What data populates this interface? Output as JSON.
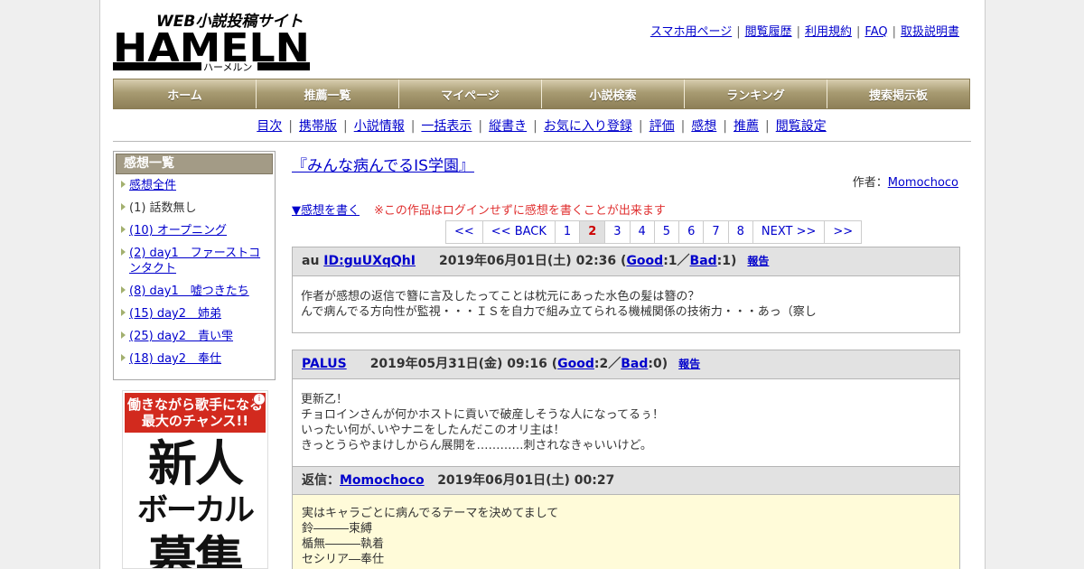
{
  "header": {
    "logo_tagline": "WEB小説投稿サイト",
    "logo_name": "HAMELN",
    "logo_kana": "ハーメルン",
    "links": [
      "スマホ用ページ",
      "閲覧履歴",
      "利用規約",
      "FAQ",
      "取扱説明書"
    ]
  },
  "global_nav": [
    "ホーム",
    "推薦一覧",
    "マイページ",
    "小説検索",
    "ランキング",
    "捜索掲示板"
  ],
  "sub_nav": [
    "目次",
    "携帯版",
    "小説情報",
    "一括表示",
    "縦書き",
    "お気に入り登録",
    "評価",
    "感想",
    "推薦",
    "閲覧設定"
  ],
  "sidebar": {
    "title": "感想一覧",
    "items": [
      {
        "label": "感想全件",
        "link": true
      },
      {
        "label": "(1) 話数無し",
        "link": false
      },
      {
        "label": "(10) オープニング",
        "link": true
      },
      {
        "label": "(2) day1　ファーストコンタクト",
        "link": true
      },
      {
        "label": "(8) day1　嘘つきたち",
        "link": true
      },
      {
        "label": "(15) day2　姉弟",
        "link": true
      },
      {
        "label": "(25) day2　青い雫",
        "link": true
      },
      {
        "label": "(18) day2　奉仕",
        "link": true
      }
    ]
  },
  "ad": {
    "line1": "働きながら歌手になる",
    "line2": "最大のチャンス!!",
    "big": "新人",
    "mid": "ボーカル",
    "cut": "募集"
  },
  "main": {
    "title": "『みんな病んでるIS学園』",
    "author_label": "作者：",
    "author": "Momochoco",
    "write_link": "▼感想を書く",
    "warning": "※この作品はログインせずに感想を書くことが出来ます",
    "pager": [
      "<<",
      "<< BACK",
      "1",
      "2",
      "3",
      "4",
      "5",
      "6",
      "7",
      "8",
      "NEXT >>",
      ">>"
    ],
    "current_page": "2",
    "reviews": [
      {
        "prefix": "au ",
        "user": "ID:guUXqQhI",
        "date": "2019年06月01日(土) 02:36",
        "good_label": "Good",
        "good": ":1",
        "slash": "／",
        "bad_label": "Bad",
        "bad": ":1",
        "report": "報告",
        "lines": [
          "作者が感想の返信で簪に言及したってことは枕元にあった水色の髪は簪の？",
          "んで病んでる方向性が監視・・・ＩＳを自力で組み立てられる機械関係の技術力・・・あっ（察し"
        ]
      },
      {
        "prefix": "",
        "user": "PALUS",
        "date": "2019年05月31日(金) 09:16",
        "good_label": "Good",
        "good": ":2",
        "slash": "／",
        "bad_label": "Bad",
        "bad": ":0",
        "report": "報告",
        "lines": [
          "更新乙！",
          "チョロインさんが何かホストに貢いで破産しそうな人になってるぅ！",
          "いったい何が､いやナニをしたんだこのオリ主は！",
          "きっとうらやまけしからん展開を…………刺されなきゃいいけど。"
        ],
        "reply": {
          "label": "返信：",
          "user": "Momochoco",
          "date": "2019年06月01日(土) 00:27",
          "lines": [
            "実はキャラごとに病んでるテーマを決めてまして",
            "鈴―――束縛",
            "楯無―――執着",
            "セシリア―奉仕"
          ]
        }
      }
    ]
  }
}
